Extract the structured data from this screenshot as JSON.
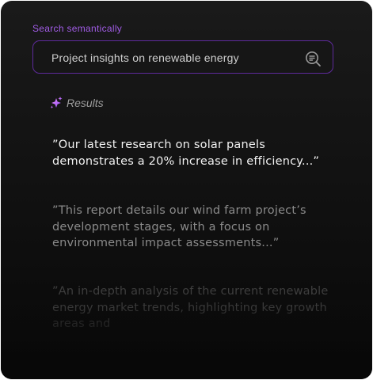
{
  "search": {
    "label": "Search semantically",
    "value": "Project insights on renewable energy"
  },
  "results": {
    "title": "Results",
    "items": [
      "”Our latest research on solar panels demonstrates a 20% increase in efficiency...”",
      "”This report details our wind farm project’s development stages, with a focus on environmental impact assessments...”",
      " ”An in-depth analysis of the current renewable energy market trends, highlighting key growth areas and"
    ]
  },
  "colors": {
    "accent": "#a15ce6",
    "border": "#5e2a9c"
  }
}
